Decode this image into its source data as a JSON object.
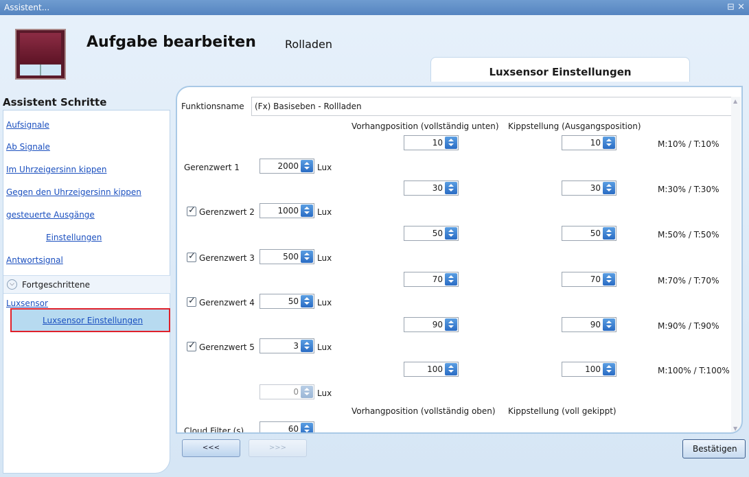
{
  "window": {
    "title": "Assistent...",
    "controls": "⊟ ✕"
  },
  "header": {
    "title": "Aufgabe bearbeiten",
    "subtitle": "Rolladen",
    "tab": "Luxsensor Einstellungen"
  },
  "steps": {
    "title": "Assistent Schritte",
    "items": [
      "Aufsignale",
      "Ab Signale",
      "Im Uhrzeigersinn kippen",
      "Gegen den Uhrzeigersinn kippen",
      "gesteuerte Ausgänge",
      "Einstellungen",
      "Antwortsignal"
    ],
    "advanced": "Fortgeschrittene",
    "luxsensor": "Luxsensor",
    "selected": "Luxsensor Einstellungen"
  },
  "form": {
    "function_label": "Funktionsname",
    "function_value": "(Fx) Basiseben - Rollladen",
    "col_curtain_down": "Vorhangposition (vollständig unten)",
    "col_tilt_start": "Kippstellung (Ausgangsposition)",
    "col_curtain_up": "Vorhangposition (vollständig oben)",
    "col_tilt_full": "Kippstellung (voll gekippt)",
    "unit": "Lux",
    "thresholds": [
      {
        "label": "Gerenzwert 1",
        "value": "2000",
        "checkbox": false
      },
      {
        "label": "Gerenzwert 2",
        "value": "1000",
        "checkbox": true
      },
      {
        "label": "Gerenzwert 3",
        "value": "500",
        "checkbox": true
      },
      {
        "label": "Gerenzwert 4",
        "value": "50",
        "checkbox": true
      },
      {
        "label": "Gerenzwert 5",
        "value": "3",
        "checkbox": true
      }
    ],
    "last_threshold": "0",
    "positions": [
      {
        "curtain": "10",
        "tilt": "10",
        "info": "M:10% / T:10%"
      },
      {
        "curtain": "30",
        "tilt": "30",
        "info": "M:30% / T:30%"
      },
      {
        "curtain": "50",
        "tilt": "50",
        "info": "M:50% / T:50%"
      },
      {
        "curtain": "70",
        "tilt": "70",
        "info": "M:70% / T:70%"
      },
      {
        "curtain": "90",
        "tilt": "90",
        "info": "M:90% / T:90%"
      },
      {
        "curtain": "100",
        "tilt": "100",
        "info": "M:100% / T:100%"
      }
    ],
    "cloud_label": "Cloud Filter (s)",
    "cloud_value": "60"
  },
  "nav": {
    "back": "<<<",
    "next": ">>>",
    "confirm": "Bestätigen"
  },
  "colors": {
    "titlebar": "#5584c0",
    "accent": "#2a6cc4",
    "highlight": "#e0202a"
  }
}
